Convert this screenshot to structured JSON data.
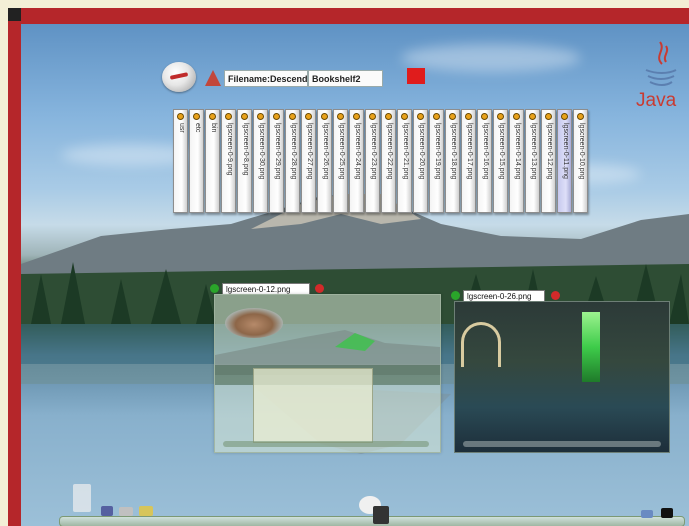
{
  "toolbar": {
    "filename_field": "Filename:Descend",
    "bookshelf_field": "Bookshelf2"
  },
  "shelf": {
    "books": [
      {
        "label": "usr"
      },
      {
        "label": "etc"
      },
      {
        "label": "bin"
      },
      {
        "label": "lgscreen-0-9.png"
      },
      {
        "label": "lgscreen-0-8.png"
      },
      {
        "label": "lgscreen-0-30.png"
      },
      {
        "label": "lgscreen-0-29.png"
      },
      {
        "label": "lgscreen-0-28.png"
      },
      {
        "label": "lgscreen-0-27.png"
      },
      {
        "label": "lgscreen-0-26.png"
      },
      {
        "label": "lgscreen-0-25.png"
      },
      {
        "label": "lgscreen-0-24.png"
      },
      {
        "label": "lgscreen-0-23.png"
      },
      {
        "label": "lgscreen-0-22.png"
      },
      {
        "label": "lgscreen-0-21.png"
      },
      {
        "label": "lgscreen-0-20.png"
      },
      {
        "label": "lgscreen-0-19.png"
      },
      {
        "label": "lgscreen-0-18.png"
      },
      {
        "label": "lgscreen-0-17.png"
      },
      {
        "label": "lgscreen-0-16.png"
      },
      {
        "label": "lgscreen-0-15.png"
      },
      {
        "label": "lgscreen-0-14.png"
      },
      {
        "label": "lgscreen-0-13.png"
      },
      {
        "label": "lgscreen-0-12.png"
      },
      {
        "label": "lgscreen-0-11.png"
      },
      {
        "label": "lgscreen-0-10.png"
      }
    ],
    "selected_index": 24
  },
  "java_logo": {
    "text": "Java"
  },
  "windows": [
    {
      "title": "lgscreen-0-12.png"
    },
    {
      "title": "lgscreen-0-26.png"
    }
  ],
  "colors": {
    "frame_red": "#b5262a",
    "accent_red": "#e01c1c",
    "java_red": "#c93b32"
  },
  "icons": {
    "toolbar": [
      "globe-icon",
      "cone-icon",
      "red-square-icon"
    ],
    "dock": [
      "tux-icon",
      "computer-icon",
      "folder-icon",
      "clock-icon",
      "bluetooth-icon"
    ]
  }
}
